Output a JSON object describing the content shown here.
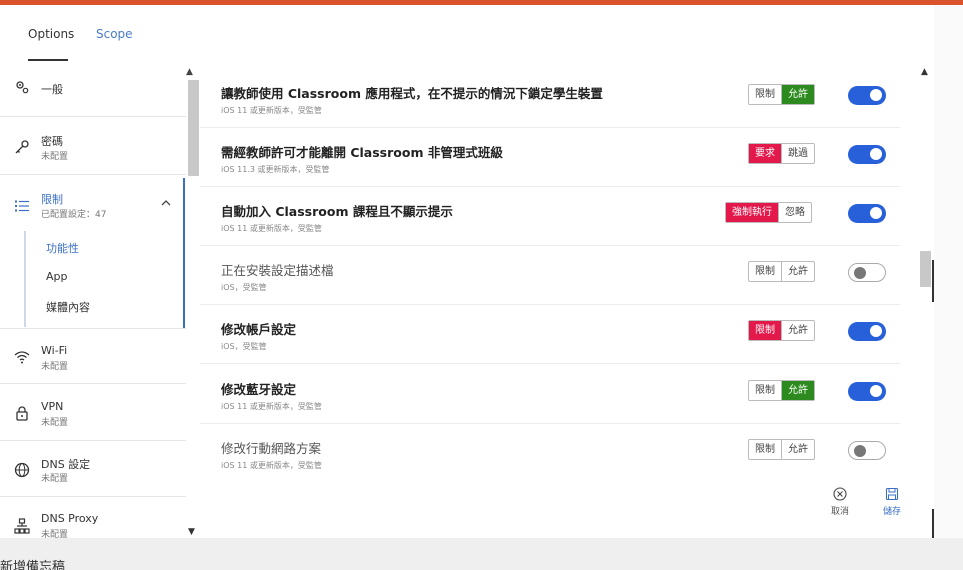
{
  "tabs": [
    {
      "label": "Options"
    },
    {
      "label": "Scope"
    }
  ],
  "sidebar": {
    "items": [
      {
        "title": "一般",
        "sub": "",
        "icon": "gear-sliders-icon"
      },
      {
        "title": "密碼",
        "sub": "未配置",
        "icon": "key-icon"
      },
      {
        "title": "限制",
        "sub": "已配置設定：47",
        "icon": "list-icon"
      },
      {
        "title": "Wi-Fi",
        "sub": "未配置",
        "icon": "wifi-icon"
      },
      {
        "title": "VPN",
        "sub": "未配置",
        "icon": "lock-icon"
      },
      {
        "title": "DNS 設定",
        "sub": "未配置",
        "icon": "globe-icon"
      },
      {
        "title": "DNS Proxy",
        "sub": "未配置",
        "icon": "network-icon"
      }
    ],
    "subitems": [
      {
        "label": "功能性"
      },
      {
        "label": "App"
      },
      {
        "label": "媒體內容"
      }
    ]
  },
  "rows": [
    {
      "title": "讓教師使用 Classroom 應用程式，在不提示的情況下鎖定學生裝置",
      "sub": "iOS 11 或更新版本，受監管",
      "left": "限制",
      "right": "允許",
      "selected": "right",
      "toggle": true
    },
    {
      "title": "需經教師許可才能離開 Classroom 非管理式班級",
      "sub": "iOS 11.3 或更新版本，受監管",
      "left": "要求",
      "right": "跳過",
      "selected": "left",
      "toggle": true
    },
    {
      "title": "自動加入 Classroom 課程且不顯示提示",
      "sub": "iOS 11 或更新版本，受監管",
      "left": "強制執行",
      "right": "忽略",
      "selected": "left",
      "toggle": true
    },
    {
      "title": "正在安裝設定描述檔",
      "sub": "iOS，受監管",
      "left": "限制",
      "right": "允許",
      "selected": "none",
      "toggle": false
    },
    {
      "title": "修改帳戶設定",
      "sub": "iOS，受監管",
      "left": "限制",
      "right": "允許",
      "selected": "left",
      "toggle": true
    },
    {
      "title": "修改藍牙設定",
      "sub": "iOS 11 或更新版本，受監管",
      "left": "限制",
      "right": "允許",
      "selected": "right",
      "toggle": true
    },
    {
      "title": "修改行動網路方案",
      "sub": "iOS 11 或更新版本，受監管",
      "left": "限制",
      "right": "允許",
      "selected": "none",
      "toggle": false
    }
  ],
  "actions": {
    "cancel": "取消",
    "save": "儲存"
  },
  "footer": {
    "text": "新增備忘稿"
  },
  "colors": {
    "accent": "#2760d8",
    "red": "#e3184b",
    "green": "#2c8a1e",
    "topbar": "#d9542c"
  }
}
